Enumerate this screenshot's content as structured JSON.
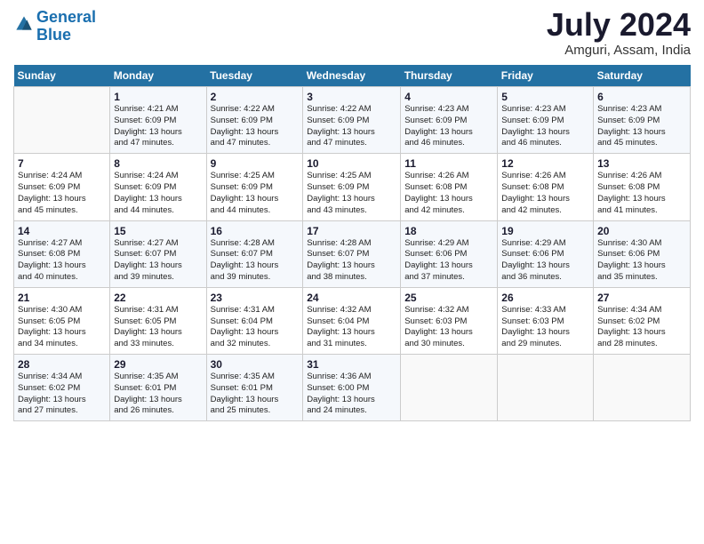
{
  "header": {
    "logo_line1": "General",
    "logo_line2": "Blue",
    "month_year": "July 2024",
    "location": "Amguri, Assam, India"
  },
  "weekdays": [
    "Sunday",
    "Monday",
    "Tuesday",
    "Wednesday",
    "Thursday",
    "Friday",
    "Saturday"
  ],
  "weeks": [
    [
      {
        "day": "",
        "info": ""
      },
      {
        "day": "1",
        "info": "Sunrise: 4:21 AM\nSunset: 6:09 PM\nDaylight: 13 hours\nand 47 minutes."
      },
      {
        "day": "2",
        "info": "Sunrise: 4:22 AM\nSunset: 6:09 PM\nDaylight: 13 hours\nand 47 minutes."
      },
      {
        "day": "3",
        "info": "Sunrise: 4:22 AM\nSunset: 6:09 PM\nDaylight: 13 hours\nand 47 minutes."
      },
      {
        "day": "4",
        "info": "Sunrise: 4:23 AM\nSunset: 6:09 PM\nDaylight: 13 hours\nand 46 minutes."
      },
      {
        "day": "5",
        "info": "Sunrise: 4:23 AM\nSunset: 6:09 PM\nDaylight: 13 hours\nand 46 minutes."
      },
      {
        "day": "6",
        "info": "Sunrise: 4:23 AM\nSunset: 6:09 PM\nDaylight: 13 hours\nand 45 minutes."
      }
    ],
    [
      {
        "day": "7",
        "info": "Sunrise: 4:24 AM\nSunset: 6:09 PM\nDaylight: 13 hours\nand 45 minutes."
      },
      {
        "day": "8",
        "info": "Sunrise: 4:24 AM\nSunset: 6:09 PM\nDaylight: 13 hours\nand 44 minutes."
      },
      {
        "day": "9",
        "info": "Sunrise: 4:25 AM\nSunset: 6:09 PM\nDaylight: 13 hours\nand 44 minutes."
      },
      {
        "day": "10",
        "info": "Sunrise: 4:25 AM\nSunset: 6:09 PM\nDaylight: 13 hours\nand 43 minutes."
      },
      {
        "day": "11",
        "info": "Sunrise: 4:26 AM\nSunset: 6:08 PM\nDaylight: 13 hours\nand 42 minutes."
      },
      {
        "day": "12",
        "info": "Sunrise: 4:26 AM\nSunset: 6:08 PM\nDaylight: 13 hours\nand 42 minutes."
      },
      {
        "day": "13",
        "info": "Sunrise: 4:26 AM\nSunset: 6:08 PM\nDaylight: 13 hours\nand 41 minutes."
      }
    ],
    [
      {
        "day": "14",
        "info": "Sunrise: 4:27 AM\nSunset: 6:08 PM\nDaylight: 13 hours\nand 40 minutes."
      },
      {
        "day": "15",
        "info": "Sunrise: 4:27 AM\nSunset: 6:07 PM\nDaylight: 13 hours\nand 39 minutes."
      },
      {
        "day": "16",
        "info": "Sunrise: 4:28 AM\nSunset: 6:07 PM\nDaylight: 13 hours\nand 39 minutes."
      },
      {
        "day": "17",
        "info": "Sunrise: 4:28 AM\nSunset: 6:07 PM\nDaylight: 13 hours\nand 38 minutes."
      },
      {
        "day": "18",
        "info": "Sunrise: 4:29 AM\nSunset: 6:06 PM\nDaylight: 13 hours\nand 37 minutes."
      },
      {
        "day": "19",
        "info": "Sunrise: 4:29 AM\nSunset: 6:06 PM\nDaylight: 13 hours\nand 36 minutes."
      },
      {
        "day": "20",
        "info": "Sunrise: 4:30 AM\nSunset: 6:06 PM\nDaylight: 13 hours\nand 35 minutes."
      }
    ],
    [
      {
        "day": "21",
        "info": "Sunrise: 4:30 AM\nSunset: 6:05 PM\nDaylight: 13 hours\nand 34 minutes."
      },
      {
        "day": "22",
        "info": "Sunrise: 4:31 AM\nSunset: 6:05 PM\nDaylight: 13 hours\nand 33 minutes."
      },
      {
        "day": "23",
        "info": "Sunrise: 4:31 AM\nSunset: 6:04 PM\nDaylight: 13 hours\nand 32 minutes."
      },
      {
        "day": "24",
        "info": "Sunrise: 4:32 AM\nSunset: 6:04 PM\nDaylight: 13 hours\nand 31 minutes."
      },
      {
        "day": "25",
        "info": "Sunrise: 4:32 AM\nSunset: 6:03 PM\nDaylight: 13 hours\nand 30 minutes."
      },
      {
        "day": "26",
        "info": "Sunrise: 4:33 AM\nSunset: 6:03 PM\nDaylight: 13 hours\nand 29 minutes."
      },
      {
        "day": "27",
        "info": "Sunrise: 4:34 AM\nSunset: 6:02 PM\nDaylight: 13 hours\nand 28 minutes."
      }
    ],
    [
      {
        "day": "28",
        "info": "Sunrise: 4:34 AM\nSunset: 6:02 PM\nDaylight: 13 hours\nand 27 minutes."
      },
      {
        "day": "29",
        "info": "Sunrise: 4:35 AM\nSunset: 6:01 PM\nDaylight: 13 hours\nand 26 minutes."
      },
      {
        "day": "30",
        "info": "Sunrise: 4:35 AM\nSunset: 6:01 PM\nDaylight: 13 hours\nand 25 minutes."
      },
      {
        "day": "31",
        "info": "Sunrise: 4:36 AM\nSunset: 6:00 PM\nDaylight: 13 hours\nand 24 minutes."
      },
      {
        "day": "",
        "info": ""
      },
      {
        "day": "",
        "info": ""
      },
      {
        "day": "",
        "info": ""
      }
    ]
  ]
}
